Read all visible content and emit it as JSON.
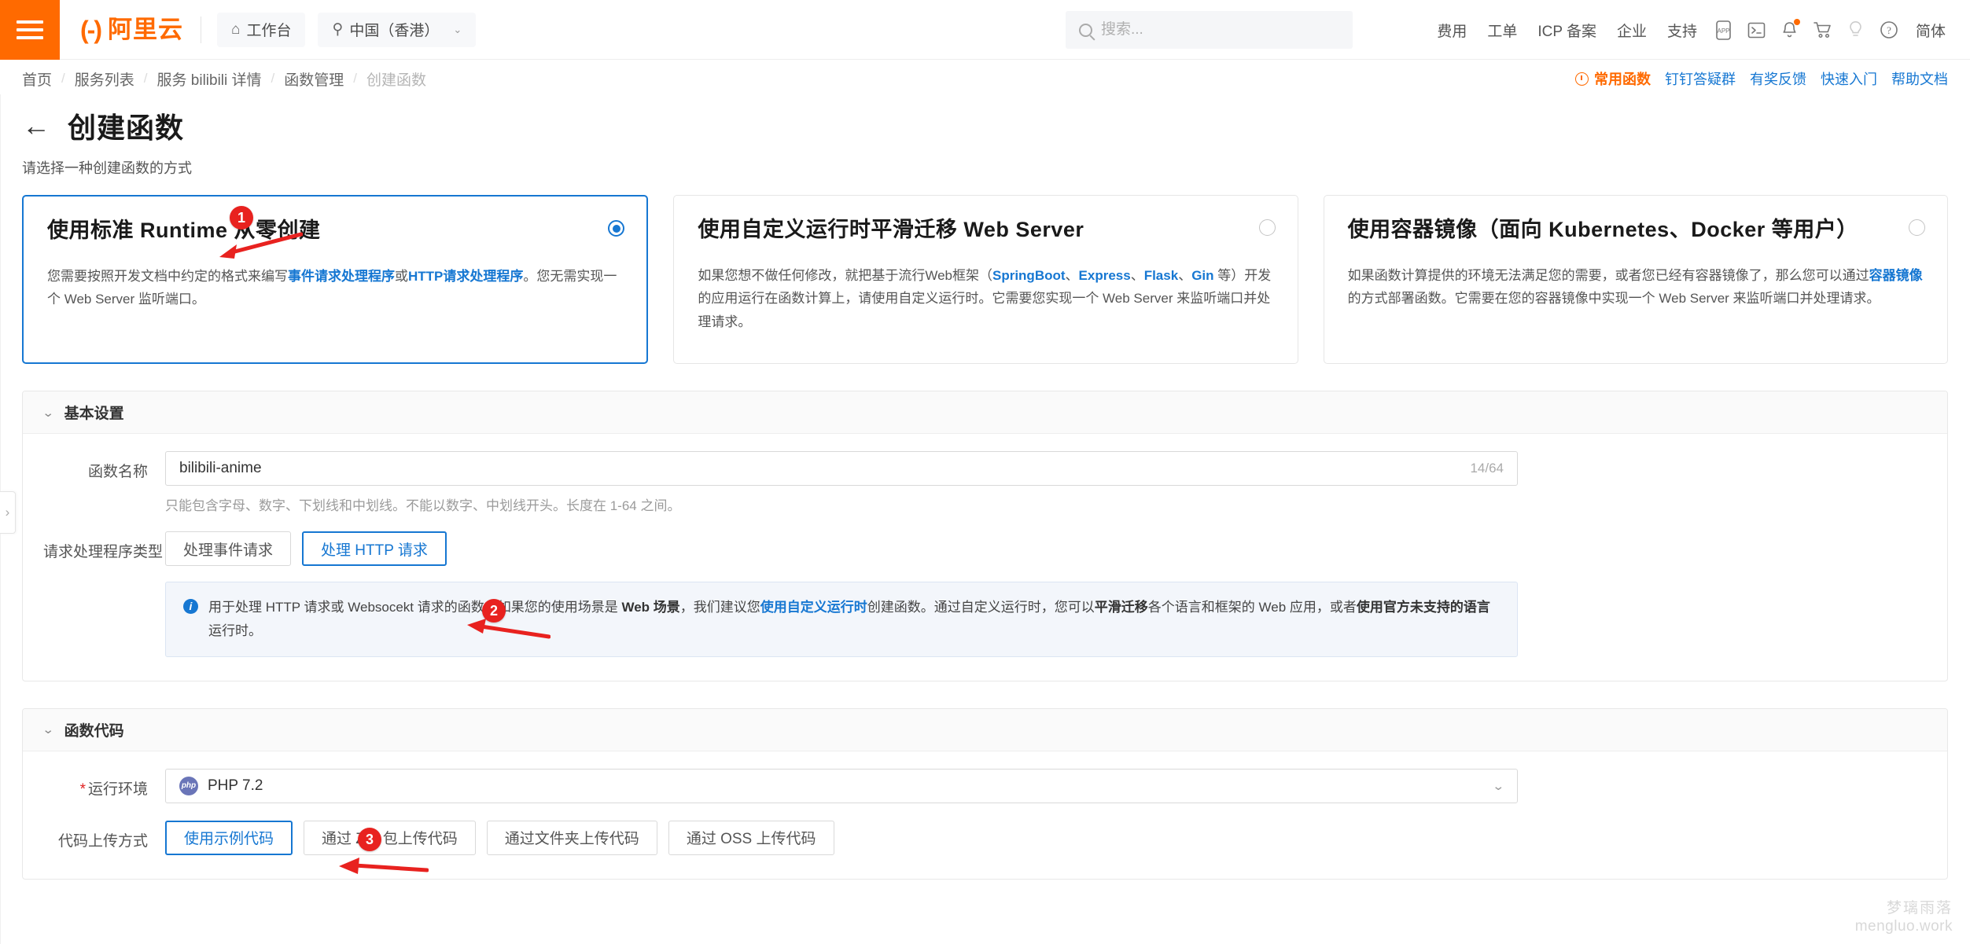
{
  "topnav": {
    "menu_icon": "hamburger-icon",
    "brand_mark": "(-)",
    "brand_text": "阿里云",
    "workbench": {
      "icon": "home-icon",
      "label": "工作台"
    },
    "region": {
      "icon": "location-pin-icon",
      "label": "中国（香港）",
      "caret": "⌄"
    },
    "search": {
      "placeholder": "搜索...",
      "value": "",
      "icon": "search-icon"
    },
    "links": [
      "费用",
      "工单",
      "ICP 备案",
      "企业",
      "支持"
    ],
    "icons": [
      "app-icon",
      "cloud-shell-icon",
      "notification-bell-icon",
      "shopping-cart-icon",
      "lightbulb-icon",
      "help-circle-icon"
    ],
    "language": "简体"
  },
  "breadcrumb": {
    "items": [
      "首页",
      "服务列表",
      "服务 bilibili 详情",
      "函数管理",
      "创建函数"
    ],
    "separator": "/"
  },
  "breadcrumb_right": {
    "hot_label": "常用函数",
    "hot_icon": "clock-icon",
    "links": [
      "钉钉答疑群",
      "有奖反馈",
      "快速入门",
      "帮助文档"
    ]
  },
  "page": {
    "back_icon": "back-arrow-icon",
    "title": "创建函数",
    "subtitle": "请选择一种创建函数的方式"
  },
  "cards": [
    {
      "title": "使用标准 Runtime 从零创建",
      "selected": true,
      "desc_parts": [
        {
          "t": "您需要按照开发文档中约定的格式来编写",
          "style": "normal"
        },
        {
          "t": "事件请求处理程序",
          "style": "link"
        },
        {
          "t": "或",
          "style": "normal"
        },
        {
          "t": "HTTP请求处理程序",
          "style": "link"
        },
        {
          "t": "。您无需实现一个 Web Server 监听端口。",
          "style": "normal"
        }
      ]
    },
    {
      "title": "使用自定义运行时平滑迁移 Web Server",
      "selected": false,
      "desc_parts": [
        {
          "t": "如果您想不做任何修改，就把基于流行Web框架（",
          "style": "normal"
        },
        {
          "t": "SpringBoot",
          "style": "link"
        },
        {
          "t": "、",
          "style": "normal"
        },
        {
          "t": "Express",
          "style": "link"
        },
        {
          "t": "、",
          "style": "normal"
        },
        {
          "t": "Flask",
          "style": "link"
        },
        {
          "t": "、",
          "style": "normal"
        },
        {
          "t": "Gin",
          "style": "link"
        },
        {
          "t": " 等）开发的应用运行在函数计算上，请使用自定义运行时。它需要您实现一个 Web Server 来监听端口并处理请求。",
          "style": "normal"
        }
      ]
    },
    {
      "title": "使用容器镜像（面向 Kubernetes、Docker 等用户）",
      "selected": false,
      "desc_parts": [
        {
          "t": "如果函数计算提供的环境无法满足您的需要，或者您已经有容器镜像了，那么您可以通过",
          "style": "normal"
        },
        {
          "t": "容器镜像",
          "style": "link"
        },
        {
          "t": "的方式部署函数。它需要在您的容器镜像中实现一个 Web Server 来监听端口并处理请求。",
          "style": "normal"
        }
      ]
    }
  ],
  "basic_settings": {
    "panel_title": "基本设置",
    "chevron": "⌄",
    "function_name": {
      "label": "函数名称",
      "value": "bilibili-anime",
      "placeholder": "",
      "counter": "14/64",
      "helper": "只能包含字母、数字、下划线和中划线。不能以数字、中划线开头。长度在 1-64 之间。"
    },
    "handler_type": {
      "label": "请求处理程序类型",
      "options": [
        "处理事件请求",
        "处理 HTTP 请求"
      ],
      "selected_index": 1
    },
    "alert": {
      "icon": "info-icon",
      "parts": [
        {
          "t": "用于处理 HTTP 请求或 Websocekt 请求的函数。如果您的使用场景是 ",
          "style": "normal"
        },
        {
          "t": "Web 场景",
          "style": "bold"
        },
        {
          "t": "，我们建议您",
          "style": "normal"
        },
        {
          "t": "使用自定义运行时",
          "style": "link"
        },
        {
          "t": "创建函数。通过自定义运行时，您可以",
          "style": "normal"
        },
        {
          "t": "平滑迁移",
          "style": "bold"
        },
        {
          "t": "各个语言和框架的 Web 应用，或者",
          "style": "normal"
        },
        {
          "t": "使用官方未支持的语言",
          "style": "bold"
        },
        {
          "t": "运行时。",
          "style": "normal"
        }
      ]
    }
  },
  "function_code": {
    "panel_title": "函数代码",
    "chevron": "⌄",
    "runtime": {
      "label": "运行环境",
      "required": true,
      "icon": "php-icon",
      "value": "PHP 7.2",
      "caret": "⌄"
    },
    "upload_method": {
      "label": "代码上传方式",
      "options": [
        "使用示例代码",
        "通过 ZIP 包上传代码",
        "通过文件夹上传代码",
        "通过 OSS 上传代码"
      ],
      "selected_index": 0
    }
  },
  "annotations": [
    {
      "number": "1",
      "target": "standard-runtime-card"
    },
    {
      "number": "2",
      "target": "http-handler-button"
    },
    {
      "number": "3",
      "target": "runtime-select"
    }
  ],
  "side_handle": {
    "icon": "chevron-right-icon"
  },
  "watermark": {
    "line1": "梦璃雨落",
    "line2": "mengluo.work"
  },
  "colors": {
    "brand_orange": "#FF6A00",
    "accent_blue": "#1677d2",
    "annotation_red": "#e8221f"
  }
}
